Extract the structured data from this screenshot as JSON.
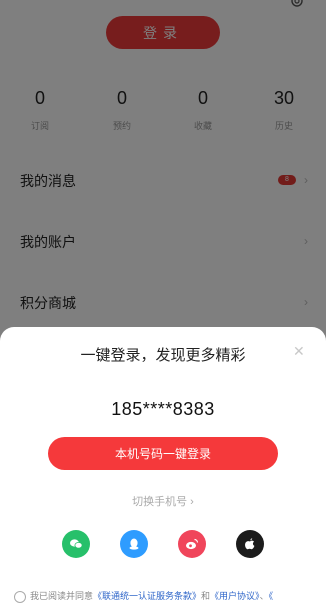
{
  "header": {
    "login_label": "登录"
  },
  "stats": [
    {
      "value": "0",
      "label": "订阅"
    },
    {
      "value": "0",
      "label": "预约"
    },
    {
      "value": "0",
      "label": "收藏"
    },
    {
      "value": "30",
      "label": "历史"
    }
  ],
  "menu": {
    "messages": {
      "label": "我的消息",
      "badge": "8"
    },
    "account": {
      "label": "我的账户"
    },
    "mall": {
      "label": "积分商城"
    }
  },
  "sheet": {
    "title": "一键登录，发现更多精彩",
    "close_icon": "close-icon",
    "phone": "185****8383",
    "onekey_label": "本机号码一键登录",
    "switch_label": "切换手机号 ›",
    "social": [
      {
        "name": "wechat-icon",
        "color": "#27c06a"
      },
      {
        "name": "qq-icon",
        "color": "#2e9cff"
      },
      {
        "name": "weibo-icon",
        "color": "#f0455b"
      },
      {
        "name": "apple-icon",
        "color": "#1c1c1c"
      }
    ],
    "agreement": {
      "prefix": "我已阅读并同意",
      "link1": "《联通统一认证服务条款》",
      "and": "和",
      "link2": "《用户协议》",
      "sep": "、",
      "link3": "《"
    }
  }
}
